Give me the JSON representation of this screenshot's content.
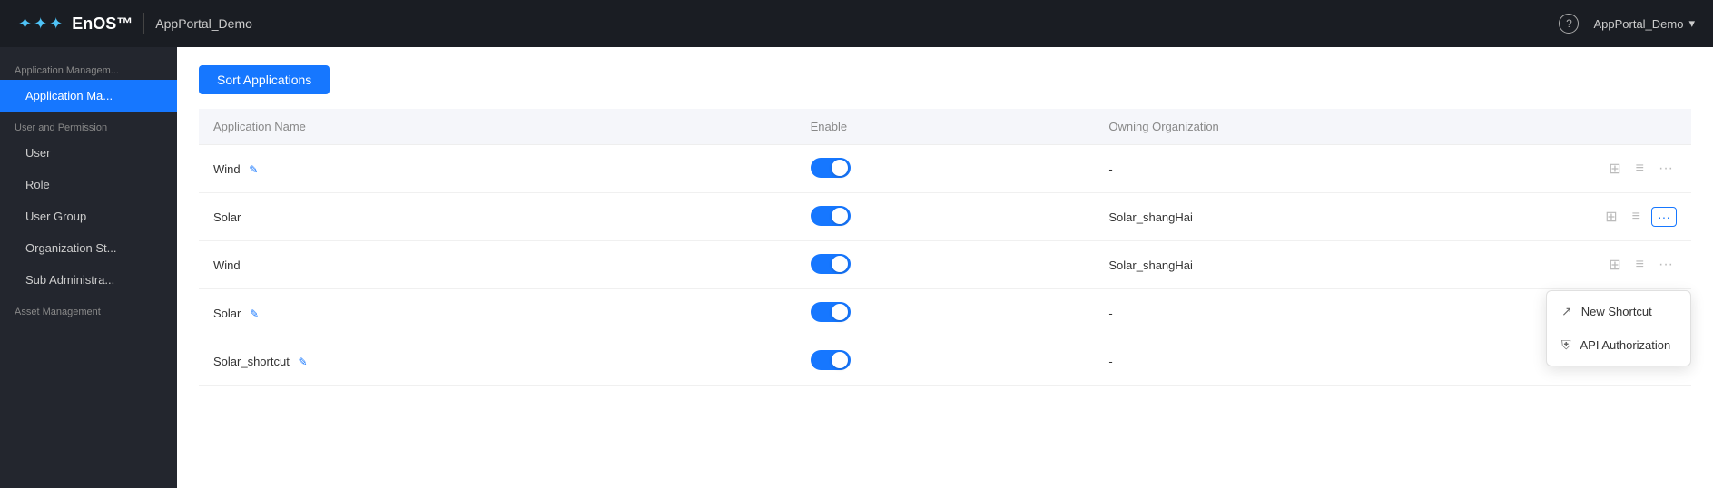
{
  "topnav": {
    "logo_dots": "✦✦✦",
    "logo_brand": "En",
    "logo_brand_suffix": "OS™",
    "app_name": "AppPortal_Demo",
    "help_icon": "?",
    "user_label": "AppPortal_Demo",
    "chevron": "▾"
  },
  "sidebar": {
    "section1_label": "Application Managem...",
    "section1_items": [
      {
        "id": "app-management",
        "label": "Application Ma...",
        "active": true
      }
    ],
    "section2_label": "User and Permission",
    "section2_items": [
      {
        "id": "user",
        "label": "User",
        "active": false
      },
      {
        "id": "role",
        "label": "Role",
        "active": false
      },
      {
        "id": "user-group",
        "label": "User Group",
        "active": false
      },
      {
        "id": "org-structure",
        "label": "Organization St...",
        "active": false
      },
      {
        "id": "sub-admin",
        "label": "Sub Administra...",
        "active": false
      }
    ],
    "section3_label": "Asset Management"
  },
  "toolbar": {
    "sort_btn_label": "Sort Applications"
  },
  "table": {
    "columns": [
      "Application Name",
      "Enable",
      "Owning Organization"
    ],
    "rows": [
      {
        "name": "Wind",
        "has_edit": true,
        "enabled": true,
        "org": "-",
        "show_more": false
      },
      {
        "name": "Solar",
        "has_edit": false,
        "enabled": true,
        "org": "Solar_shangHai",
        "show_more": true
      },
      {
        "name": "Wind",
        "has_edit": false,
        "enabled": true,
        "org": "Solar_shangHai",
        "show_more": false
      },
      {
        "name": "Solar",
        "has_edit": true,
        "enabled": true,
        "org": "-",
        "show_more": false
      },
      {
        "name": "Solar_shortcut",
        "has_edit": true,
        "enabled": true,
        "org": "-",
        "show_more": false
      }
    ]
  },
  "dropdown": {
    "items": [
      {
        "id": "new-shortcut",
        "icon": "⬛",
        "label": "New Shortcut"
      },
      {
        "id": "api-auth",
        "icon": "🛡",
        "label": "API Authorization"
      }
    ]
  },
  "icons": {
    "grid_icon": "⊞",
    "list_icon": "≡",
    "more_icon": "···",
    "edit_icon": "✎",
    "shortcut_icon": "↗",
    "shield_icon": "⛨"
  }
}
